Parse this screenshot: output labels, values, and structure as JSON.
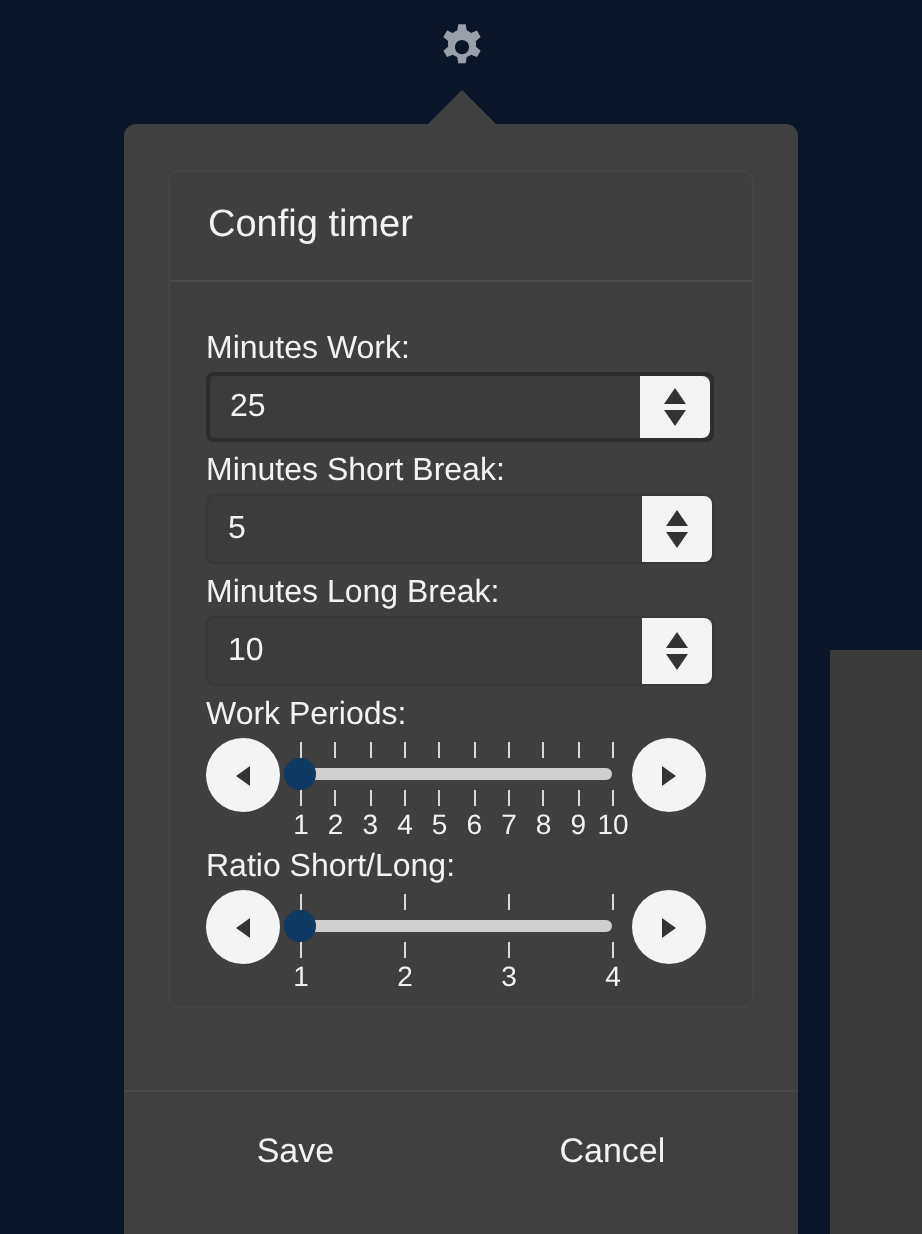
{
  "dialog": {
    "title": "Config timer"
  },
  "fields": [
    {
      "label": "Minutes Work:",
      "value": "25",
      "focused": true
    },
    {
      "label": "Minutes Short Break:",
      "value": "5",
      "focused": false
    },
    {
      "label": "Minutes Long Break:",
      "value": "10",
      "focused": false
    }
  ],
  "sliders": [
    {
      "label": "Work Periods:",
      "ticks": [
        "1",
        "2",
        "3",
        "4",
        "5",
        "6",
        "7",
        "8",
        "9",
        "10"
      ],
      "level": 0
    },
    {
      "label": "Ratio Short/Long:",
      "ticks": [
        "1",
        "2",
        "3",
        "4"
      ],
      "level": 0
    }
  ],
  "buttons": [
    "Save",
    "Cancel"
  ]
}
